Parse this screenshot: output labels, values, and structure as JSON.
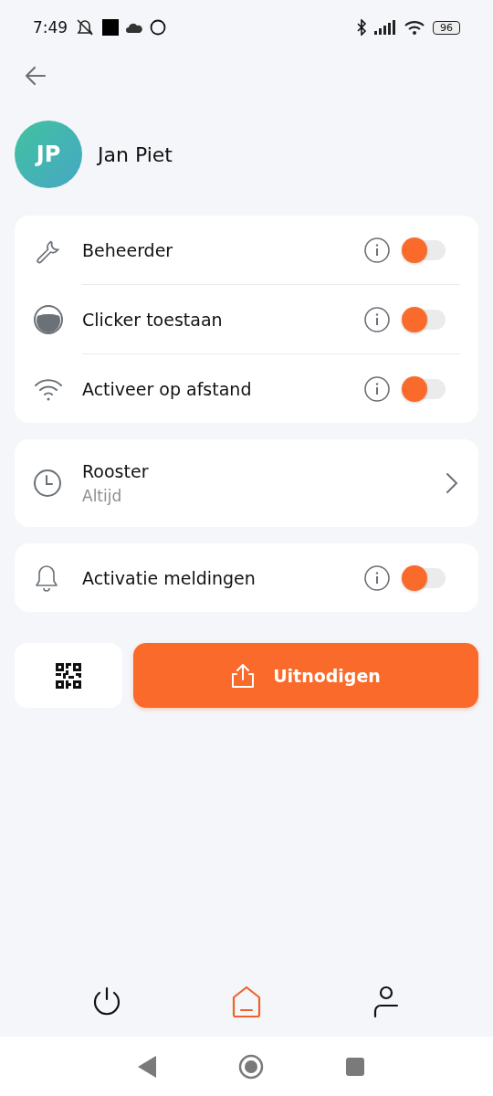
{
  "status_bar": {
    "time": "7:49",
    "battery": "96"
  },
  "profile": {
    "initials": "JP",
    "name": "Jan Piet"
  },
  "cards": [
    {
      "rows": [
        {
          "kind": "toggle",
          "label": "Beheerder",
          "on": false
        },
        {
          "kind": "toggle",
          "label": "Clicker toestaan",
          "on": false
        },
        {
          "kind": "toggle",
          "label": "Activeer op afstand",
          "on": false
        }
      ]
    },
    {
      "rows": [
        {
          "kind": "link",
          "label": "Rooster",
          "subtitle": "Altijd"
        }
      ]
    },
    {
      "rows": [
        {
          "kind": "toggle",
          "label": "Activatie meldingen",
          "on": false
        }
      ]
    }
  ],
  "invite_button": {
    "label": "Uitnodigen"
  },
  "bottom_nav": [
    {
      "selected": false
    },
    {
      "selected": true
    },
    {
      "selected": false
    }
  ]
}
